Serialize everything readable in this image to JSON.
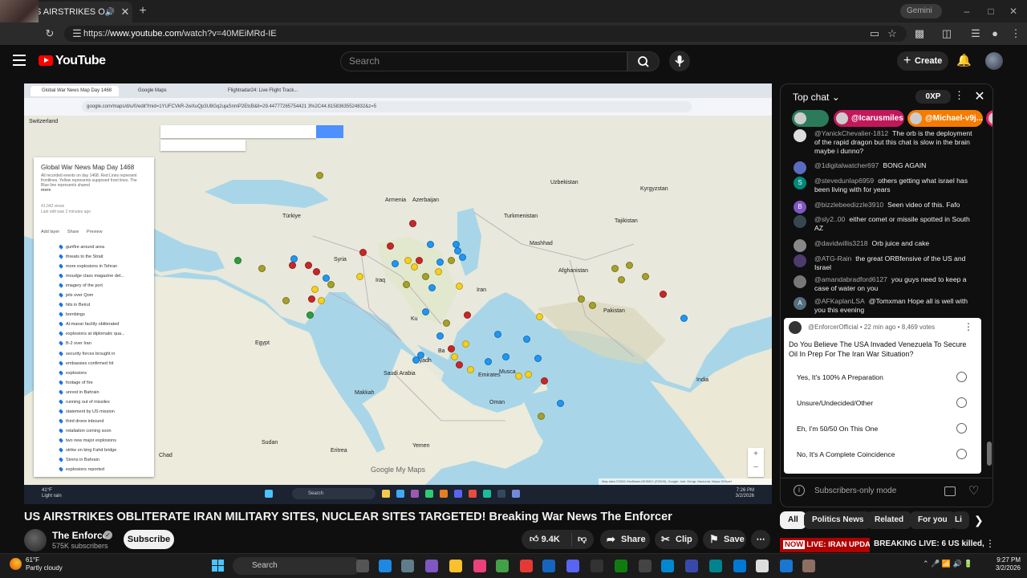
{
  "browser": {
    "tab_title": "US AIRSTRIKES OBLITERATE",
    "gemini_label": "Gemini",
    "url_prefix": "https://",
    "url_host": "www.youtube.com",
    "url_path": "/watch?v=40MEiMRd-IE"
  },
  "youtube": {
    "logo_text": "YouTube",
    "search_placeholder": "Search",
    "create_label": "Create"
  },
  "video": {
    "inner_tabs": [
      "Global War News Map Day 1468",
      "Google Maps",
      "Flightradar24: Live Flight Track..."
    ],
    "inner_url": "google.com/maps/d/u/0/edit?mid=1YUFCVkR-2wXuQp3U8Gq2ujaSnmP2EtcB&ll=29.44777265754421 3%2C44.81583635524832&z=5",
    "panel": {
      "title": "Global War News Map Day 1468",
      "description": "All recorded events on day 1468. Red Lines represent frontlines. Yellow represents supposed front lines. The Blue line represents shared",
      "more": "more",
      "views": "41,042 views",
      "edited": "Last edit was 2 minutes ago",
      "add_layer": "Add layer",
      "share": "Share",
      "preview": "Preview",
      "layers": [
        "gunfire around area",
        "threats to the Strait",
        "more explosions in Tehran",
        "moudge class magazine det...",
        "imagery of the port",
        "jets over Qom",
        "hits in Beirut",
        "bombings",
        "Al-manar facility obliterated",
        "explosions at diplomatic qua...",
        "B-2 over Iran",
        "security forces brought in",
        "embassies confirmed hit",
        "explosions",
        "footage of fire",
        "unrest in Bahrain",
        "running out of missiles",
        "statement by US mission",
        "third drone inbound",
        "retaliation coming soon",
        "two new major explosions",
        "strike on king Fahd bridge",
        "Sirens in Bahrain",
        "explosions reported"
      ]
    },
    "map_labels": {
      "switzerland": "Switzerland",
      "uzbekistan": "Uzbekistan",
      "kyrgyzstan": "Kyrgyzstan",
      "armenia": "Armenia",
      "azerbaijan": "Azerbaijan",
      "turkiye": "Türkiye",
      "turkmenistan": "Turkmenistan",
      "tajikistan": "Tajikistan",
      "mashhad": "Mashhad",
      "syria": "Syria",
      "iraq": "Iraq",
      "iran": "Iran",
      "afghanistan": "Afghanistan",
      "pakistan": "Pakistan",
      "egypt": "Egypt",
      "kuwait": "Ku",
      "bahrain": "Ba",
      "riyadh": "Riyadh",
      "emirates": "Emirates",
      "muscat": "Musca",
      "saudi": "Saudi Arabia",
      "oman": "Oman",
      "makkah": "Makkah",
      "eritrea": "Eritrea",
      "sudan": "Sudan",
      "yemen": "Yemen",
      "chad": "Chad",
      "india": "India",
      "google": "Google My Maps"
    },
    "attribution": "Map data ©2026 GeoBasis-DE/BKG (©2009), Google, Inst. Geogr. Nacional, Mapa GISrael",
    "taskbar_temp": "41°F",
    "taskbar_weather": "Light rain",
    "taskbar_search": "Search",
    "taskbar_time": "7:26 PM",
    "taskbar_date": "3/2/2026"
  },
  "meta": {
    "title": "US AIRSTRIKES OBLITERATE IRAN MILITARY SITES, NUCLEAR SITES TARGETED! Breaking War News The Enforcer",
    "channel": "The Enforcer",
    "subscribers": "575K subscribers",
    "subscribe_label": "Subscribe",
    "likes": "9.4K",
    "share_label": "Share",
    "clip_label": "Clip",
    "save_label": "Save"
  },
  "chat": {
    "title": "Top chat",
    "xp": "0XP",
    "tickers": [
      {
        "name": "",
        "color": "#2b7b5a"
      },
      {
        "name": "@Icarusmiles",
        "color": "#c2185b"
      },
      {
        "name": "@Michael-v9j...",
        "color": "#f57c00"
      },
      {
        "name": "",
        "color": "#e91e63"
      }
    ],
    "messages": [
      {
        "author": "@YanickChevalier-1812",
        "text": "The orb is the deployment of the rapid dragon but this chat is slow in the brain maybe i dunno?",
        "avatar": "",
        "color": "#ddd"
      },
      {
        "author": "@1digitalwatcher697",
        "text": "BONG AGAIN",
        "avatar": "",
        "color": "#5c6bc0"
      },
      {
        "author": "@stevedunlap6959",
        "text": "others getting what israel has been living with for years",
        "avatar": "S",
        "color": "#00897b"
      },
      {
        "author": "@bizzlebeedizzle3910",
        "text": "Seen video of this. Fafo",
        "avatar": "B",
        "color": "#7e57c2"
      },
      {
        "author": "@sly2..00",
        "text": "either comet or missile spotted in South AZ",
        "avatar": "",
        "color": "#37474f"
      },
      {
        "author": "@davidwillis3218",
        "text": "Orb juice and cake",
        "avatar": "",
        "color": "#888"
      },
      {
        "author": "@ATG-Rain",
        "text": "the great ORBfensive of the US and Israel",
        "avatar": "",
        "color": "#4e3b6e"
      },
      {
        "author": "@amandabradford6127",
        "text": "you guys need to keep a case of water on you",
        "avatar": "",
        "color": "#777"
      },
      {
        "author": "@AFKaplanLSA",
        "text": "@Tomxman Hope all is well with you this evening",
        "avatar": "A",
        "color": "#546e7a"
      }
    ],
    "poll": {
      "author": "@EnforcerOfficial",
      "time": "22 min ago",
      "votes": "8,469 votes",
      "question": "Do You Believe The USA Invaded Venezuela To Secure Oil In Prep For The Iran War Situation?",
      "options": [
        "Yes, It's 100% A Preparation",
        "Unsure/Undecided/Other",
        "Eh, I'm 50/50 On This One",
        "No, It's A Complete Coincidence"
      ]
    },
    "subscribers_only": "Subscribers-only mode"
  },
  "chips": [
    "All",
    "Politics News",
    "Related",
    "For you",
    "Li"
  ],
  "recommendation": {
    "thumb_now": "NOW",
    "thumb_text": "LIVE: IRAN UPDATES",
    "title": "BREAKING LIVE: 6 US killed,"
  },
  "taskbar": {
    "temp": "61°F",
    "weather": "Partly cloudy",
    "search": "Search",
    "time": "9:27 PM",
    "date": "3/2/2026"
  }
}
